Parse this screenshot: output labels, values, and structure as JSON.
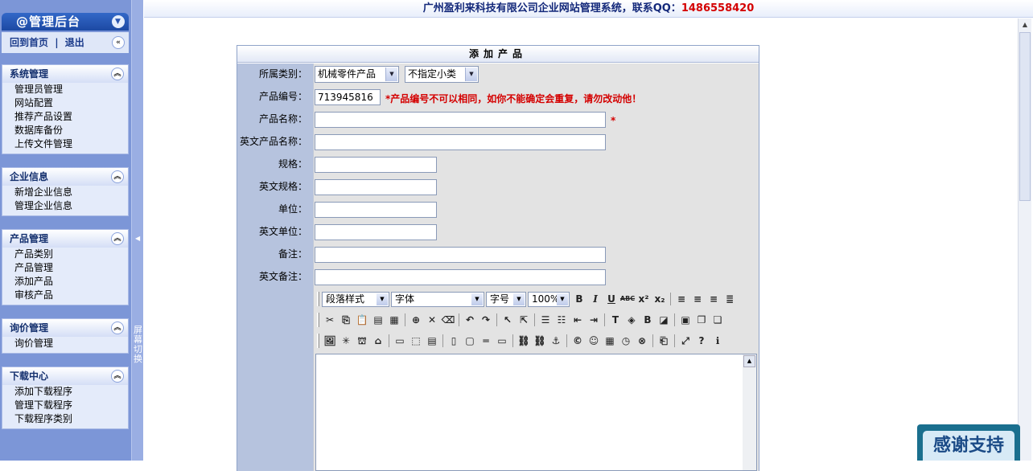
{
  "sidebar": {
    "brand": "@管理后台",
    "home_link": "回到首页",
    "logout_link": "退出",
    "separator": "|",
    "groups": [
      {
        "title": "系统管理",
        "items": [
          "管理员管理",
          "网站配置",
          "推荐产品设置",
          "数据库备份",
          "上传文件管理"
        ]
      },
      {
        "title": "企业信息",
        "items": [
          "新增企业信息",
          "管理企业信息"
        ]
      },
      {
        "title": "产品管理",
        "items": [
          "产品类别",
          "产品管理",
          "添加产品",
          "审核产品"
        ]
      },
      {
        "title": "询价管理",
        "items": [
          "询价管理"
        ]
      },
      {
        "title": "下载中心",
        "items": [
          "添加下载程序",
          "管理下载程序",
          "下载程序类别"
        ]
      }
    ]
  },
  "splitter": {
    "label": "屏幕切换"
  },
  "header": {
    "title": "广州盈利来科技有限公司企业网站管理系统，联系QQ：",
    "qq": "1486558420"
  },
  "form": {
    "title": "添加产品",
    "category_label": "所属类别：",
    "category_value": "机械零件产品",
    "subcategory_value": "不指定小类",
    "code_label": "产品编号：",
    "code_value": "713945816",
    "code_note": "*产品编号不可以相同，如你不能确定会重复，请勿改动他！",
    "name_label": "产品名称：",
    "name_required": "*",
    "en_name_label": "英文产品名称：",
    "spec_label": "规格：",
    "en_spec_label": "英文规格：",
    "unit_label": "单位：",
    "en_unit_label": "英文单位：",
    "remark_label": "备注：",
    "en_remark_label": "英文备注："
  },
  "editor": {
    "paragraph_style": "段落样式",
    "font": "字体",
    "font_size": "字号",
    "zoom": "100%"
  },
  "badge": {
    "text": "感谢支持"
  }
}
